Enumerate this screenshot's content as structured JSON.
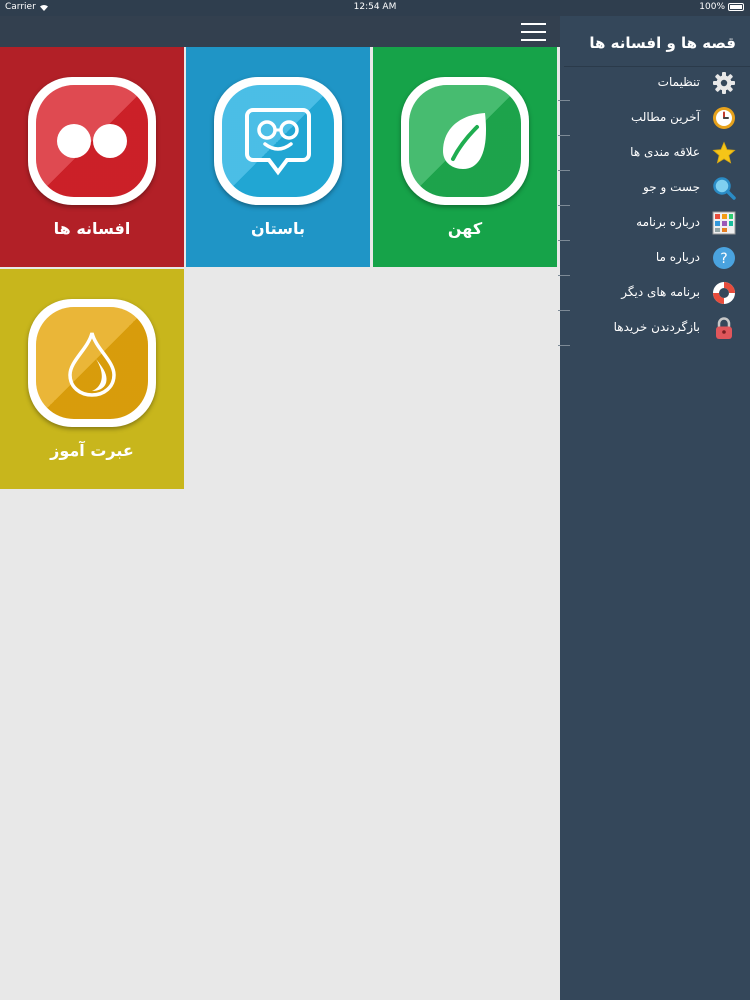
{
  "status_bar": {
    "carrier": "Carrier",
    "time": "12:54 AM",
    "battery": "100%"
  },
  "sidebar": {
    "title": "قصه ها و افسانه ها",
    "items": [
      {
        "label": "تنظیمات",
        "icon": "gear-icon"
      },
      {
        "label": "آخرین مطالب",
        "icon": "clock-icon"
      },
      {
        "label": "علاقه مندی ها",
        "icon": "star-icon"
      },
      {
        "label": "جست و جو",
        "icon": "search-icon"
      },
      {
        "label": "درباره برنامه",
        "icon": "grid-icon"
      },
      {
        "label": "درباره ما",
        "icon": "question-icon"
      },
      {
        "label": "برنامه های دیگر",
        "icon": "lifebuoy-icon"
      },
      {
        "label": "بازگردندن خریدها",
        "icon": "lock-icon"
      }
    ]
  },
  "tiles": [
    {
      "label": "افسانه ها",
      "icon": "two-dots-icon",
      "color": "#b22027"
    },
    {
      "label": "باستان",
      "icon": "smiley-glasses-icon",
      "color": "#1f95c6"
    },
    {
      "label": "کهن",
      "icon": "leaf-icon",
      "color": "#16a349"
    },
    {
      "label": "عبرت آموز",
      "icon": "drop-icon",
      "color": "#c8b61c"
    }
  ]
}
